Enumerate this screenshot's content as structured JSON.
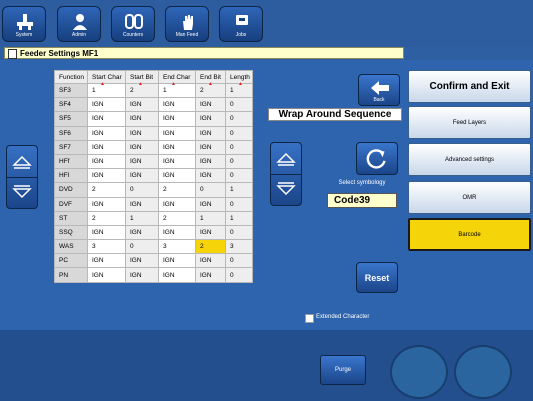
{
  "nav": [
    {
      "label": "System",
      "icon": "system-icon"
    },
    {
      "label": "Admin",
      "icon": "user-icon"
    },
    {
      "label": "Counters",
      "icon": "counter-icon"
    },
    {
      "label": "Man Feed",
      "icon": "hand-icon"
    },
    {
      "label": "Jobs",
      "icon": "jobs-icon"
    }
  ],
  "header": {
    "title": "Feeder Settings MF1"
  },
  "table": {
    "columns": [
      "Function",
      "Start Char",
      "Start Bit",
      "End Char",
      "End Bit",
      "Length"
    ],
    "rows": [
      {
        "fn": "SF3",
        "sc": "1",
        "sb": "2",
        "ec": "1",
        "eb": "2",
        "len": "1"
      },
      {
        "fn": "SF4",
        "sc": "IGN",
        "sb": "IGN",
        "ec": "IGN",
        "eb": "IGN",
        "len": "0"
      },
      {
        "fn": "SF5",
        "sc": "IGN",
        "sb": "IGN",
        "ec": "IGN",
        "eb": "IGN",
        "len": "0"
      },
      {
        "fn": "SF6",
        "sc": "IGN",
        "sb": "IGN",
        "ec": "IGN",
        "eb": "IGN",
        "len": "0"
      },
      {
        "fn": "SF7",
        "sc": "IGN",
        "sb": "IGN",
        "ec": "IGN",
        "eb": "IGN",
        "len": "0"
      },
      {
        "fn": "HFf",
        "sc": "IGN",
        "sb": "IGN",
        "ec": "IGN",
        "eb": "IGN",
        "len": "0"
      },
      {
        "fn": "HFI",
        "sc": "IGN",
        "sb": "IGN",
        "ec": "IGN",
        "eb": "IGN",
        "len": "0"
      },
      {
        "fn": "DVD",
        "sc": "2",
        "sb": "0",
        "ec": "2",
        "eb": "0",
        "len": "1"
      },
      {
        "fn": "DVF",
        "sc": "IGN",
        "sb": "IGN",
        "ec": "IGN",
        "eb": "IGN",
        "len": "0"
      },
      {
        "fn": "ST",
        "sc": "2",
        "sb": "1",
        "ec": "2",
        "eb": "1",
        "len": "1"
      },
      {
        "fn": "SSQ",
        "sc": "IGN",
        "sb": "IGN",
        "ec": "IGN",
        "eb": "IGN",
        "len": "0"
      },
      {
        "fn": "WAS",
        "sc": "3",
        "sb": "0",
        "ec": "3",
        "eb": "2",
        "len": "3"
      },
      {
        "fn": "PC",
        "sc": "IGN",
        "sb": "IGN",
        "ec": "IGN",
        "eb": "IGN",
        "len": "0"
      },
      {
        "fn": "PN",
        "sc": "IGN",
        "sb": "IGN",
        "ec": "IGN",
        "eb": "IGN",
        "len": "0"
      }
    ]
  },
  "back": {
    "label": "Back"
  },
  "wrap_around": "Wrap Around Sequence",
  "symbology": {
    "label": "Select symbology",
    "value": "Code39"
  },
  "reset": "Reset",
  "extended": {
    "label": "Extended Character",
    "checked": false
  },
  "side": {
    "confirm": "Confirm and Exit",
    "feed_layers": "Feed Layers",
    "advanced": "Advanced settings",
    "omr": "OMR",
    "barcode": "Barcode"
  },
  "purge": "Purge",
  "colors": {
    "background": "#2e63ad",
    "selected": "#f5d50a",
    "header": "#ffffcc"
  }
}
